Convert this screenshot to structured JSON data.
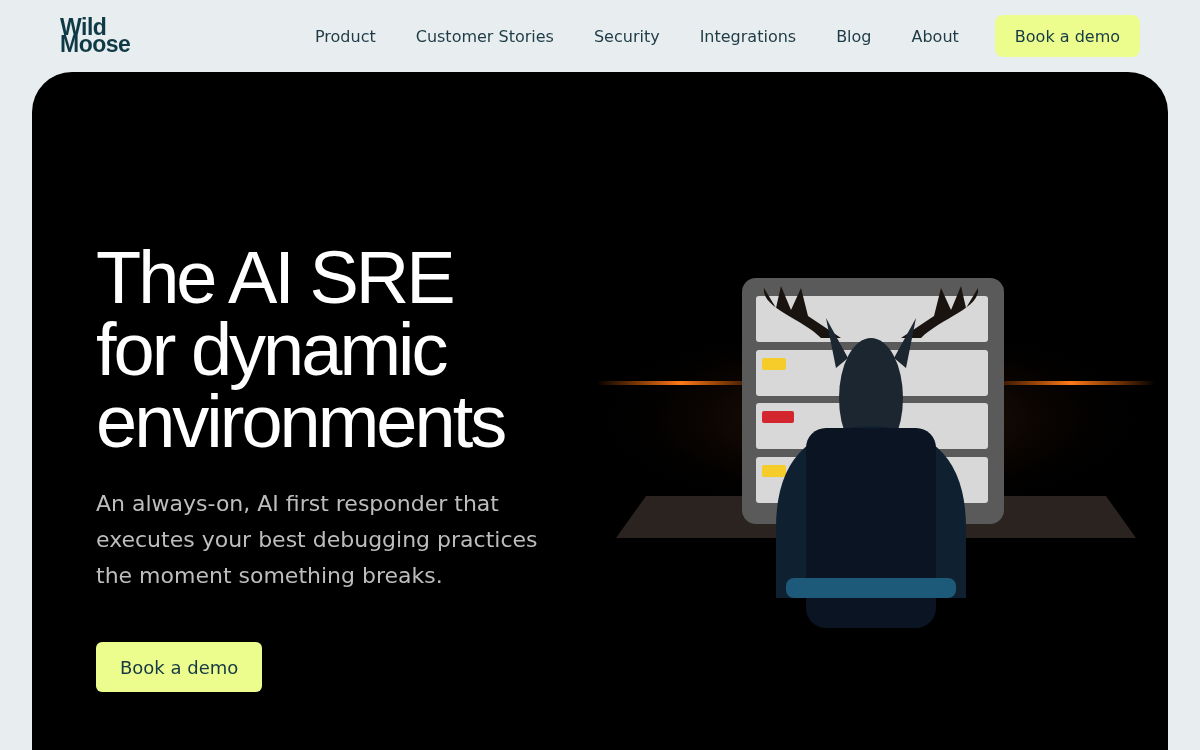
{
  "header": {
    "logo": [
      "Wild",
      "Moose"
    ],
    "nav": [
      "Product",
      "Customer Stories",
      "Security",
      "Integrations",
      "Blog",
      "About"
    ],
    "cta": "Book a demo"
  },
  "hero": {
    "title": [
      "The AI SRE",
      "for dynamic",
      "environments"
    ],
    "subtitle": "An always-on, AI first responder that executes your best debugging practices the moment something breaks.",
    "cta": "Book a demo"
  }
}
